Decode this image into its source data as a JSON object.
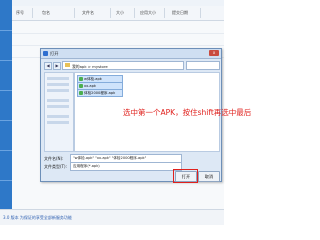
{
  "header": {
    "columns": [
      "序号",
      "包名",
      "文件名",
      "大小",
      "应用大小",
      "提交日期"
    ]
  },
  "dialog": {
    "title": "打开",
    "close_label": "x",
    "path": "我的apk > mystore",
    "files": [
      {
        "name": "w体检.apk"
      },
      {
        "name": "xx.apk"
      },
      {
        "name": "体检2000程序.apk"
      }
    ],
    "hint": "选中第一个APK，按住shift再选中最后",
    "filename_label": "文件名(N):",
    "filename_value": "\"w体检.apk\" \"xx.apk\" \"体检2000程序.apk\"",
    "filetype_label": "文件类型(T):",
    "filetype_value": "应用程序(*.apk)",
    "open_button": "打开",
    "cancel_button": "取消"
  },
  "footer": {
    "text": "3.0 版本 为保证的享受全部新服务功能"
  },
  "colors": {
    "accent": "#2e78c8",
    "highlight": "#e0211d"
  }
}
